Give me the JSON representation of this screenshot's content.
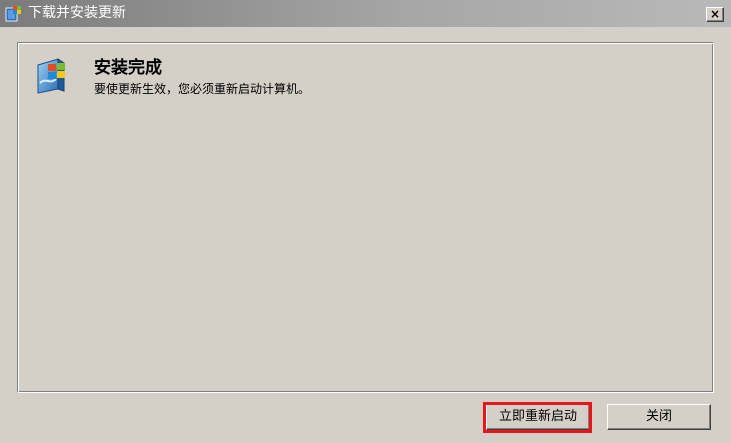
{
  "window": {
    "title": "下载并安装更新",
    "close_glyph": "×"
  },
  "content": {
    "heading": "安装完成",
    "message": "要使更新生效，您必须重新启动计算机。"
  },
  "buttons": {
    "restart_label": "立即重新启动",
    "close_label": "关闭"
  },
  "colors": {
    "dialog_background": "#d4d0c8",
    "highlight_outline": "#e8161b"
  },
  "icons": {
    "title_icon": "windows-update-icon",
    "content_icon": "windows-update-icon"
  }
}
